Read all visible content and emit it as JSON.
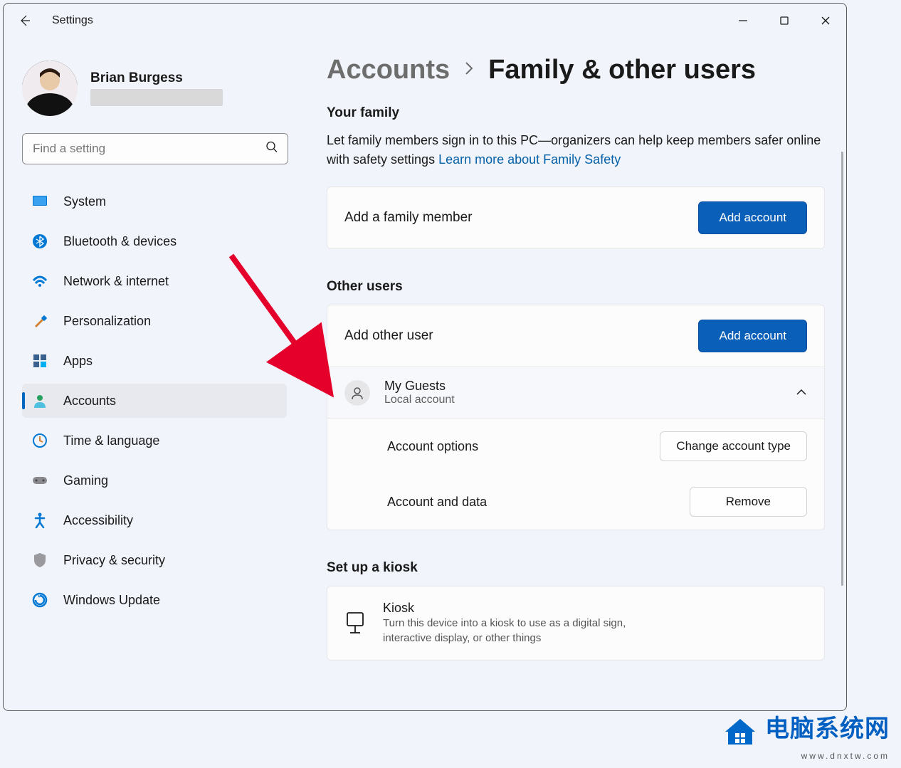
{
  "app": {
    "title": "Settings"
  },
  "user": {
    "name": "Brian Burgess"
  },
  "search": {
    "placeholder": "Find a setting"
  },
  "nav": [
    {
      "label": "System"
    },
    {
      "label": "Bluetooth & devices"
    },
    {
      "label": "Network & internet"
    },
    {
      "label": "Personalization"
    },
    {
      "label": "Apps"
    },
    {
      "label": "Accounts"
    },
    {
      "label": "Time & language"
    },
    {
      "label": "Gaming"
    },
    {
      "label": "Accessibility"
    },
    {
      "label": "Privacy & security"
    },
    {
      "label": "Windows Update"
    }
  ],
  "breadcrumb": {
    "parent": "Accounts",
    "current": "Family & other users"
  },
  "family": {
    "heading": "Your family",
    "description": "Let family members sign in to this PC—organizers can help keep members safer online with safety settings  ",
    "link": "Learn more about Family Safety",
    "add_label": "Add a family member",
    "add_button": "Add account"
  },
  "other": {
    "heading": "Other users",
    "add_label": "Add other user",
    "add_button": "Add account",
    "account": {
      "name": "My Guests",
      "type": "Local account",
      "options_label": "Account options",
      "change_type_button": "Change account type",
      "data_label": "Account and data",
      "remove_button": "Remove"
    }
  },
  "kiosk": {
    "heading": "Set up a kiosk",
    "title": "Kiosk",
    "description": "Turn this device into a kiosk to use as a digital sign, interactive display, or other things"
  },
  "watermark": {
    "main": "电脑系统网",
    "sub": "www.dnxtw.com"
  }
}
